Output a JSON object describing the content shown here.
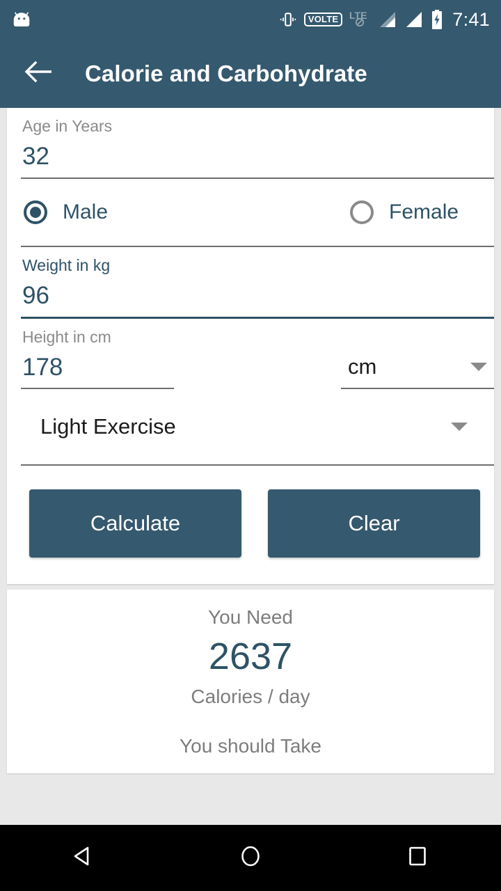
{
  "status_bar": {
    "app_icon": "android-head-icon",
    "icons": [
      "vibrate-icon",
      "volte-badge",
      "lte-no-data-icon",
      "signal-bars-icon",
      "signal-bars-icon",
      "battery-charging-icon"
    ],
    "volte_label": "VOLTE",
    "lte_label": "LTE",
    "time": "7:41"
  },
  "app_bar": {
    "back_icon": "arrow-left-icon",
    "title": "Calorie and Carbohydrate"
  },
  "form": {
    "age": {
      "label": "Age in Years",
      "value": "32",
      "placeholder": "Age in Years"
    },
    "gender": {
      "male_label": "Male",
      "female_label": "Female",
      "selected": "Male"
    },
    "weight": {
      "label": "Weight in kg",
      "value": "96",
      "placeholder": "Weight in kg"
    },
    "height": {
      "label": "Height in cm",
      "value": "178",
      "placeholder": "Height in cm"
    },
    "unit_select": {
      "value": "cm",
      "caret_icon": "chevron-down-icon"
    },
    "exercise_select": {
      "value": "Light Exercise",
      "caret_icon": "chevron-down-icon"
    },
    "calculate_label": "Calculate",
    "clear_label": "Clear"
  },
  "result": {
    "need_caption": "You Need",
    "calories_value": "2637",
    "calories_units": "Calories / day",
    "take_caption": "You should Take"
  },
  "nav_bar": {
    "back_icon": "nav-back-triangle-icon",
    "home_icon": "nav-home-circle-icon",
    "recents_icon": "nav-recents-square-icon"
  },
  "colors": {
    "primary": "#35596e",
    "accent_text": "#2e5266",
    "muted_text": "#8a8a8a",
    "page_bg": "#e8e8e8",
    "card_bg": "#ffffff",
    "nav_bg": "#000000"
  }
}
